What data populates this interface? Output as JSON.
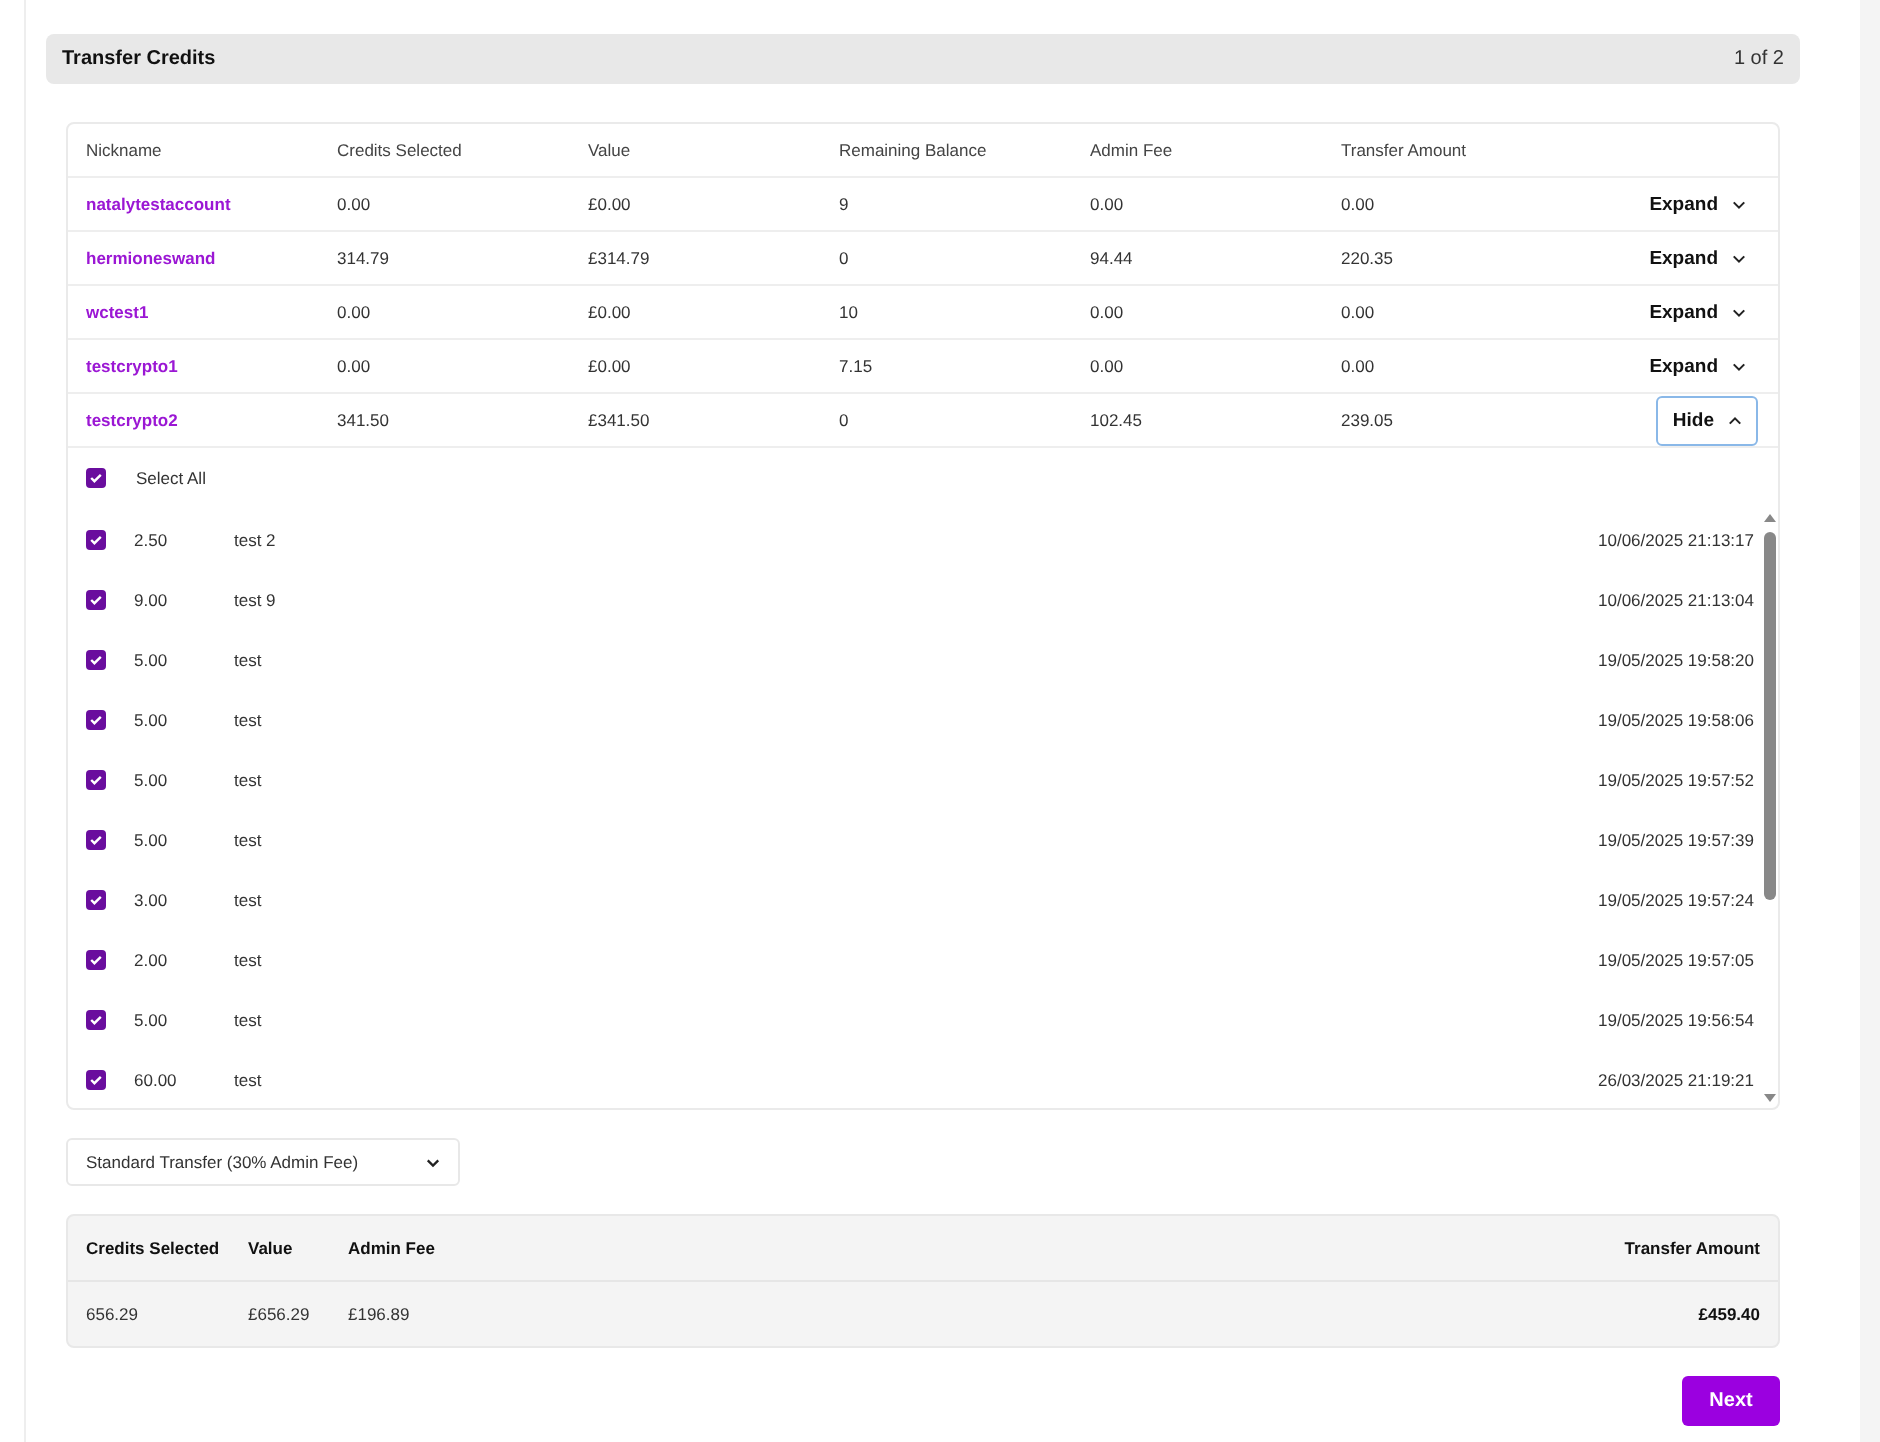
{
  "header": {
    "title": "Transfer Credits",
    "page": "1 of 2"
  },
  "table": {
    "columns": [
      "Nickname",
      "Credits Selected",
      "Value",
      "Remaining Balance",
      "Admin Fee",
      "Transfer Amount"
    ],
    "rows": [
      {
        "nickname": "natalytestaccount",
        "credits": "0.00",
        "value": "£0.00",
        "remaining": "9",
        "fee": "0.00",
        "transfer": "0.00",
        "toggle": "Expand",
        "expanded": false
      },
      {
        "nickname": "hermioneswand",
        "credits": "314.79",
        "value": "£314.79",
        "remaining": "0",
        "fee": "94.44",
        "transfer": "220.35",
        "toggle": "Expand",
        "expanded": false
      },
      {
        "nickname": "wctest1",
        "credits": "0.00",
        "value": "£0.00",
        "remaining": "10",
        "fee": "0.00",
        "transfer": "0.00",
        "toggle": "Expand",
        "expanded": false
      },
      {
        "nickname": "testcrypto1",
        "credits": "0.00",
        "value": "£0.00",
        "remaining": "7.15",
        "fee": "0.00",
        "transfer": "0.00",
        "toggle": "Expand",
        "expanded": false
      },
      {
        "nickname": "testcrypto2",
        "credits": "341.50",
        "value": "£341.50",
        "remaining": "0",
        "fee": "102.45",
        "transfer": "239.05",
        "toggle": "Hide",
        "expanded": true
      }
    ]
  },
  "credit_list": {
    "select_all": {
      "label": "Select All",
      "checked": true
    },
    "items": [
      {
        "amount": "2.50",
        "note": "test 2",
        "date": "10/06/2025 21:13:17",
        "checked": true
      },
      {
        "amount": "9.00",
        "note": "test 9",
        "date": "10/06/2025 21:13:04",
        "checked": true
      },
      {
        "amount": "5.00",
        "note": "test",
        "date": "19/05/2025 19:58:20",
        "checked": true
      },
      {
        "amount": "5.00",
        "note": "test",
        "date": "19/05/2025 19:58:06",
        "checked": true
      },
      {
        "amount": "5.00",
        "note": "test",
        "date": "19/05/2025 19:57:52",
        "checked": true
      },
      {
        "amount": "5.00",
        "note": "test",
        "date": "19/05/2025 19:57:39",
        "checked": true
      },
      {
        "amount": "3.00",
        "note": "test",
        "date": "19/05/2025 19:57:24",
        "checked": true
      },
      {
        "amount": "2.00",
        "note": "test",
        "date": "19/05/2025 19:57:05",
        "checked": true
      },
      {
        "amount": "5.00",
        "note": "test",
        "date": "19/05/2025 19:56:54",
        "checked": true
      },
      {
        "amount": "60.00",
        "note": "test",
        "date": "26/03/2025 21:19:21",
        "checked": true
      }
    ]
  },
  "transfer_type": {
    "value": "Standard Transfer (30% Admin Fee)"
  },
  "summary": {
    "columns": [
      "Credits Selected",
      "Value",
      "Admin Fee",
      "Transfer Amount"
    ],
    "values": [
      "656.29",
      "£656.29",
      "£196.89",
      "£459.40"
    ]
  },
  "next_button": "Next"
}
